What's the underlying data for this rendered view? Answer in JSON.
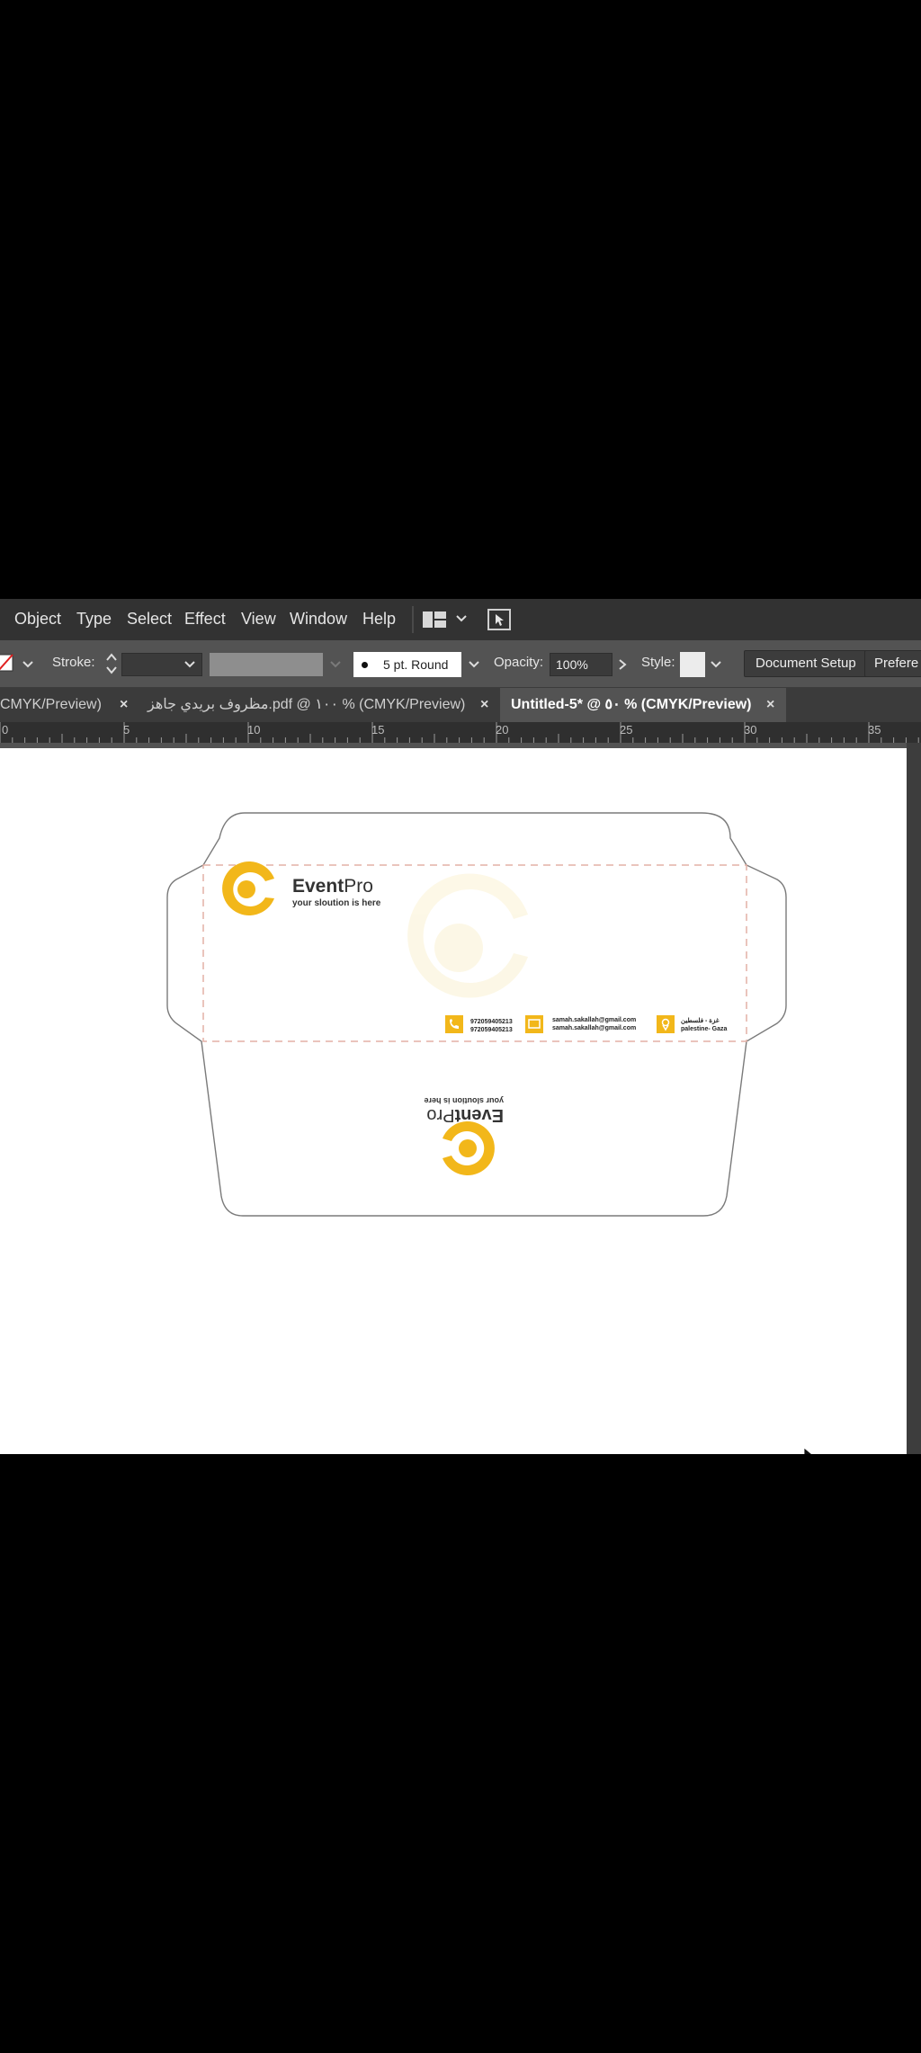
{
  "menu": {
    "items": [
      "Object",
      "Type",
      "Select",
      "Effect",
      "View",
      "Window",
      "Help"
    ]
  },
  "control_bar": {
    "stroke_label": "Stroke:",
    "brush_label": "5 pt. Round",
    "opacity_label": "Opacity:",
    "opacity_value": "100%",
    "style_label": "Style:",
    "document_setup": "Document Setup",
    "preferences": "Prefere"
  },
  "tabs": [
    {
      "label": "CMYK/Preview)",
      "close": "×"
    },
    {
      "label": "مظروف بريدي جاهز.pdf @ ١٠٠ % (CMYK/Preview)",
      "close": "×"
    },
    {
      "label": "Untitled-5* @ ٥٠ % (CMYK/Preview)",
      "close": "×"
    }
  ],
  "ruler": {
    "labels": [
      "0",
      "5",
      "10",
      "15",
      "20",
      "25",
      "30",
      "35"
    ]
  },
  "envelope": {
    "brand_name_bold": "Event",
    "brand_name_light": "Pro",
    "tagline": "your sloution is here",
    "phone_1": "972059405213",
    "phone_2": "972059405213",
    "email_1": "samah.sakallah@gmail.com",
    "email_2": "samah.sakallah@gmail.com",
    "address_1": "غزة - فلسطين",
    "address_2": "palestine- Gaza",
    "accent_color": "#f2b71a"
  },
  "icons": [
    "workspace-icon",
    "arrange-documents-icon",
    "stroke-stepper-icon",
    "brush-dot-icon",
    "phone-icon",
    "email-icon",
    "location-icon",
    "mouse-cursor-icon"
  ]
}
